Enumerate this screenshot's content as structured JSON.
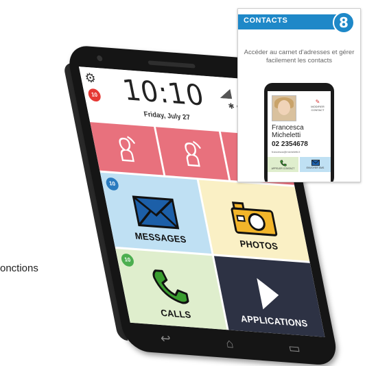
{
  "status": {
    "time": "10:10",
    "date": "Friday, July 27",
    "notification_count": "10"
  },
  "tiles": {
    "messages": {
      "label": "MESSAGES",
      "badge": "10"
    },
    "photos": {
      "label": "PHOTOS"
    },
    "calls": {
      "label": "CALLS",
      "badge": "10"
    },
    "applications": {
      "label": "APPLICATIONS"
    }
  },
  "inset": {
    "title": "CONTACTS",
    "description": "Accéder au carnet d'adresses et gérer facilement les contacts",
    "contact": {
      "first_name": "Francesca",
      "last_name": "Micheletti",
      "phone": "02 2354678",
      "email": "francesca@micheletti.it",
      "edit_label": "MODIFIER CONTACT",
      "call_label": "APPELER CONTACT",
      "mail_label": "ENVOYER SMS"
    }
  },
  "caption": "onctions",
  "colors": {
    "favorite": "#e8717d",
    "messages": "#bfe0f3",
    "photos": "#faf0c5",
    "calls": "#dfeecd",
    "applications": "#2d3244",
    "inset_accent": "#1e88c8"
  }
}
